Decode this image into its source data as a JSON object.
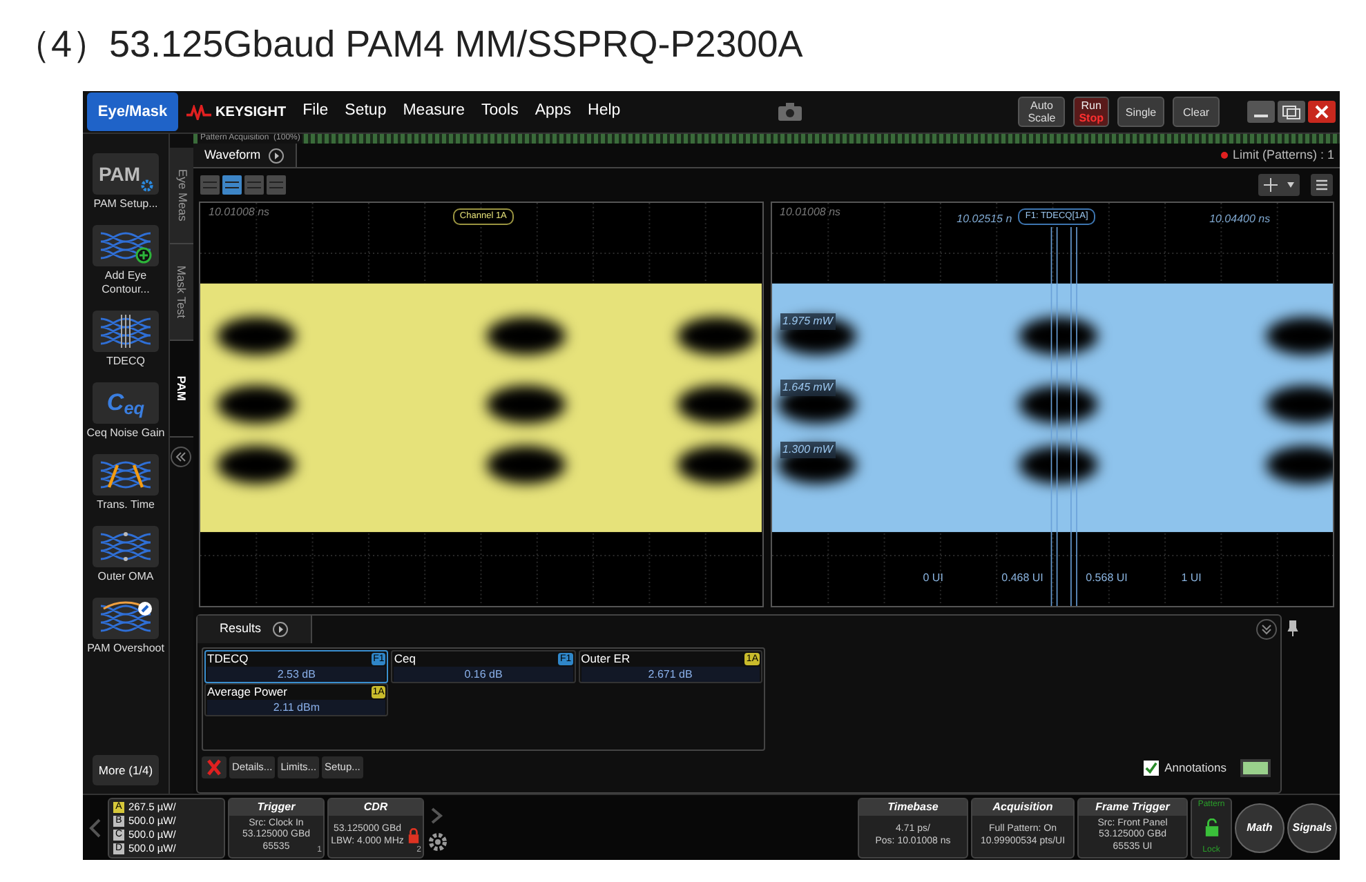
{
  "page_title": "（4）53.125Gbaud PAM4 MM/SSPRQ-P2300A",
  "top_bar": {
    "mode_button": "Eye/Mask",
    "brand": "KEYSIGHT",
    "menu": [
      "File",
      "Setup",
      "Measure",
      "Tools",
      "Apps",
      "Help"
    ],
    "buttons": [
      {
        "label": "Auto Scale",
        "kind": "plain"
      },
      {
        "label": "Run",
        "sublabel": "Stop",
        "kind": "runstop"
      },
      {
        "label": "Single",
        "kind": "plain"
      },
      {
        "label": "Clear",
        "kind": "plain"
      }
    ]
  },
  "acquisition": {
    "label": "Pattern Acquisition  (100%)",
    "level": 1
  },
  "waveform_tab": "Waveform",
  "limit_status": "Limit (Patterns) : 1",
  "side_tabs": [
    {
      "label": "Eye Meas",
      "selected": false
    },
    {
      "label": "Mask Test",
      "selected": false
    },
    {
      "label": "PAM",
      "selected": true
    }
  ],
  "measurements": [
    {
      "label": "PAM Setup...",
      "kind": "pam",
      "icon_text": "PAM"
    },
    {
      "label": "Add Eye Contour...",
      "kind": "contour"
    },
    {
      "label": "TDECQ",
      "kind": "tdecq"
    },
    {
      "label": "Ceq Noise Gain",
      "kind": "ceq",
      "icon_text": "C$_{eq}$"
    },
    {
      "label": "Trans. Time",
      "kind": "trans"
    },
    {
      "label": "Outer OMA",
      "kind": "oma"
    },
    {
      "label": "PAM Overshoot",
      "kind": "overshoot"
    }
  ],
  "more_button": "More (1/4)",
  "panels": [
    {
      "kind": "channel",
      "timestamp": "10.01008 ns",
      "badge": "Channel 1A",
      "color": "#e6e27a"
    },
    {
      "kind": "function",
      "timestamp": "10.01008 ns",
      "badge": "F1: TDECQ[1A]",
      "color": "#8ec3ec",
      "time_markers": [
        "10.02515 n",
        "10.04400 ns"
      ],
      "level_labels": [
        "1.975 mW",
        "1.645 mW",
        "1.300 mW"
      ],
      "ui_labels": [
        "0 UI",
        "0.468 UI",
        "0.568 UI",
        "1 UI"
      ]
    }
  ],
  "results": {
    "tab": "Results",
    "cells": [
      {
        "name": "TDECQ",
        "source": "F1",
        "color": "#2f86c8",
        "value": "2.53 dB",
        "selected": true
      },
      {
        "name": "Ceq",
        "source": "F1",
        "color": "#2f86c8",
        "value": "0.16 dB",
        "selected": false
      },
      {
        "name": "Outer ER",
        "source": "1A",
        "color": "#c9bb2c",
        "value": "2.671 dB",
        "selected": false
      },
      {
        "name": "Average Power",
        "source": "1A",
        "color": "#c9bb2c",
        "value": "2.11 dBm",
        "selected": false
      }
    ],
    "buttons": [
      "Details...",
      "Limits...",
      "Setup..."
    ],
    "annotations": {
      "label": "Annotations",
      "checked": true
    }
  },
  "status_bar": {
    "channels": [
      {
        "letter": "A",
        "value": "267.5 µW/",
        "color": "#d6c83a"
      },
      {
        "letter": "B",
        "value": "500.0 µW/",
        "color": "#bdbdbd"
      },
      {
        "letter": "C",
        "value": "500.0 µW/",
        "color": "#bdbdbd"
      },
      {
        "letter": "D",
        "value": "500.0 µW/",
        "color": "#bdbdbd"
      }
    ],
    "left_panels": [
      {
        "title": "Trigger",
        "lines": [
          "Src: Clock In",
          "53.125000 GBd",
          "65535"
        ],
        "corner": "1",
        "locked": false
      },
      {
        "title": "CDR",
        "lines": [
          "53.125000 GBd",
          "LBW: 4.000 MHz"
        ],
        "corner": "2",
        "locked": true
      }
    ],
    "right_panels": [
      {
        "title": "Timebase",
        "lines": [
          "4.71 ps/",
          "Pos: 10.01008 ns"
        ]
      },
      {
        "title": "Acquisition",
        "lines": [
          "Full Pattern: On",
          "10.99900534 pts/UI"
        ]
      },
      {
        "title": "Frame Trigger",
        "lines": [
          "Src: Front Panel",
          "53.125000 GBd",
          "65535 UI"
        ]
      }
    ],
    "pattern_lock": {
      "top": "Pattern",
      "bottom": "Lock"
    },
    "round_buttons": [
      "Math",
      "Signals"
    ]
  }
}
